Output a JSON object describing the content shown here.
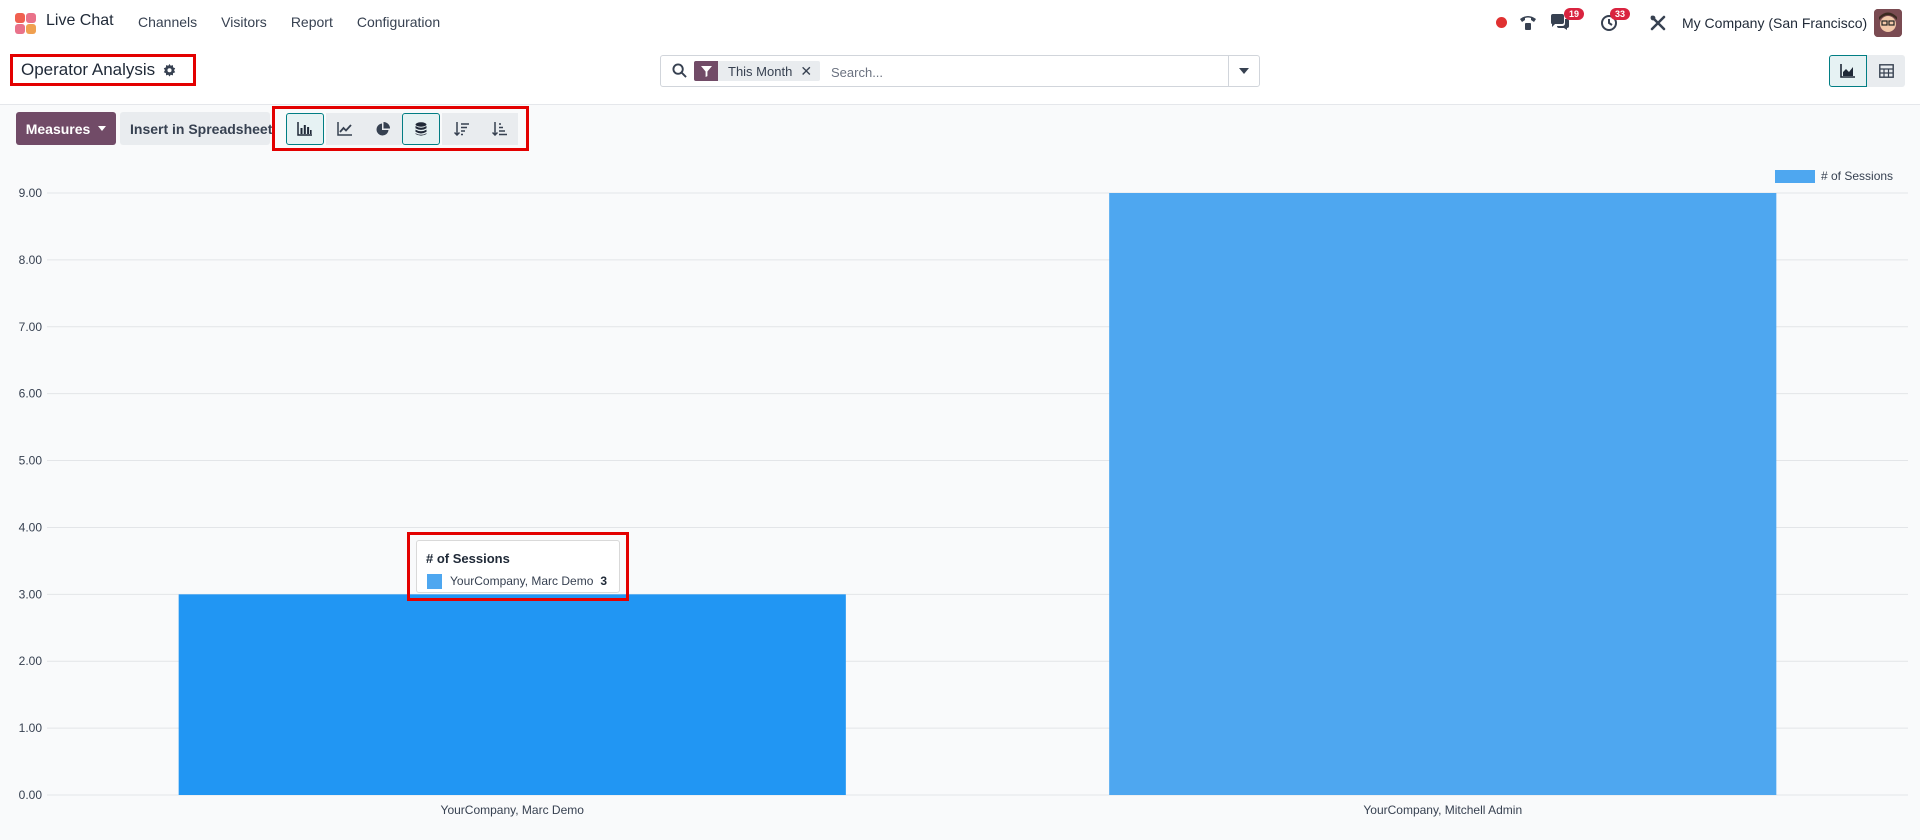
{
  "app": {
    "name": "Live Chat"
  },
  "menu": [
    "Channels",
    "Visitors",
    "Report",
    "Configuration"
  ],
  "systray": {
    "messages_badge": "19",
    "activities_badge": "33",
    "company": "My Company (San Francisco)"
  },
  "breadcrumb": {
    "title": "Operator Analysis"
  },
  "search": {
    "facet_label": "This Month",
    "placeholder": "Search..."
  },
  "toolbar": {
    "measures_label": "Measures",
    "spreadsheet_label": "Insert in Spreadsheet"
  },
  "colors": {
    "accent": "#714b67",
    "bar": "#4ea7f0",
    "bar_active": "#2196f3",
    "highlight": "#e30000"
  },
  "chart_data": {
    "type": "bar",
    "categories": [
      "YourCompany, Marc Demo",
      "YourCompany, Mitchell Admin"
    ],
    "series": [
      {
        "name": "# of Sessions",
        "values": [
          3,
          9
        ]
      }
    ],
    "ylim": [
      0,
      9
    ],
    "yticks": [
      "0.00",
      "1.00",
      "2.00",
      "3.00",
      "4.00",
      "5.00",
      "6.00",
      "7.00",
      "8.00",
      "9.00"
    ],
    "legend": "top-right",
    "grid": true
  },
  "tooltip": {
    "title": "# of Sessions",
    "label": "YourCompany, Marc Demo",
    "value": "3"
  }
}
